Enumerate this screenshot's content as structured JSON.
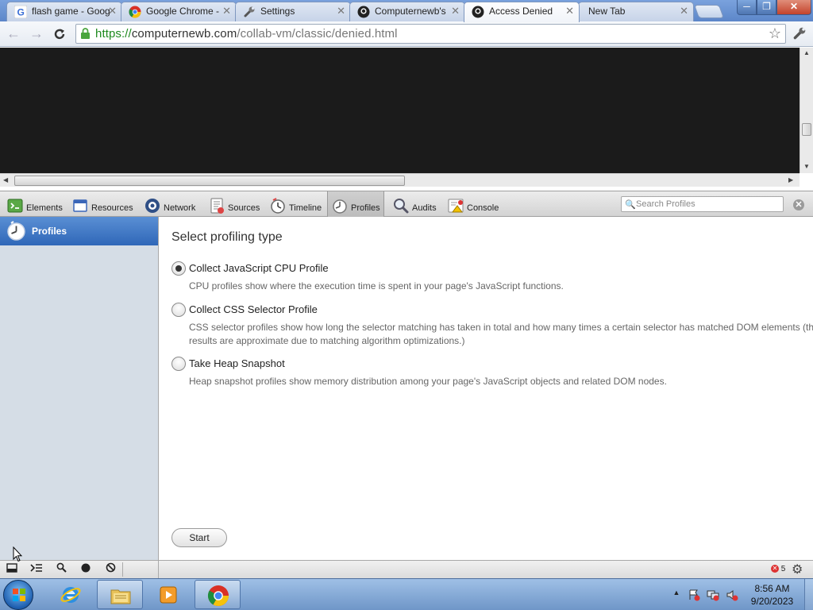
{
  "tabs": [
    {
      "label": "flash game - Goog",
      "icon": "google-icon"
    },
    {
      "label": "Google Chrome -",
      "icon": "chrome-icon"
    },
    {
      "label": "Settings",
      "icon": "wrench-icon"
    },
    {
      "label": "Computernewb's",
      "icon": "github-icon"
    },
    {
      "label": "Access Denied",
      "icon": "github-icon",
      "active": true
    },
    {
      "label": "New Tab",
      "icon": ""
    }
  ],
  "window": {
    "minimize": "─",
    "maximize": "❐",
    "close": "✕"
  },
  "toolbar": {
    "back": "←",
    "forward": "→",
    "reload": "C",
    "url_scheme": "https://",
    "url_host": "computernewb.com",
    "url_path": "/collab-vm/classic/denied.html",
    "star": "☆",
    "wrench": "🔧"
  },
  "devtools": {
    "tabs": [
      {
        "label": "Elements",
        "icon": "elements-icon",
        "color": "#4a9b3a"
      },
      {
        "label": "Resources",
        "icon": "resources-icon",
        "color": "#3a66b8"
      },
      {
        "label": "Network",
        "icon": "network-icon",
        "color": "#2f4f86"
      },
      {
        "label": "Sources",
        "icon": "sources-icon",
        "color": "#7a7a7a"
      },
      {
        "label": "Timeline",
        "icon": "timeline-icon",
        "color": "#8a8a8a"
      },
      {
        "label": "Profiles",
        "icon": "profiles-icon",
        "color": "#9a9a9a",
        "active": true
      },
      {
        "label": "Audits",
        "icon": "audits-icon",
        "color": "#6a7d95"
      },
      {
        "label": "Console",
        "icon": "console-icon",
        "color": "#c44"
      }
    ],
    "search_placeholder": "Search Profiles",
    "close": "✕",
    "sidebar": {
      "selected": "Profiles"
    },
    "main": {
      "heading": "Select profiling type",
      "options": [
        {
          "title": "Collect JavaScript CPU Profile",
          "desc": "CPU profiles show where the execution time is spent in your page's JavaScript functions.",
          "checked": true
        },
        {
          "title": "Collect CSS Selector Profile",
          "desc": "CSS selector profiles show how long the selector matching has taken in total and how many times a certain selector has matched DOM elements (the results are approximate due to matching algorithm optimizations.)",
          "checked": false
        },
        {
          "title": "Take Heap Snapshot",
          "desc": "Heap snapshot profiles show memory distribution among your page's JavaScript objects and related DOM nodes.",
          "checked": false
        }
      ],
      "start": "Start"
    },
    "status": {
      "error_count": "5"
    }
  },
  "taskbar": {
    "clock_time": "8:56 AM",
    "clock_date": "9/20/2023",
    "tray_chevron": "▲"
  }
}
